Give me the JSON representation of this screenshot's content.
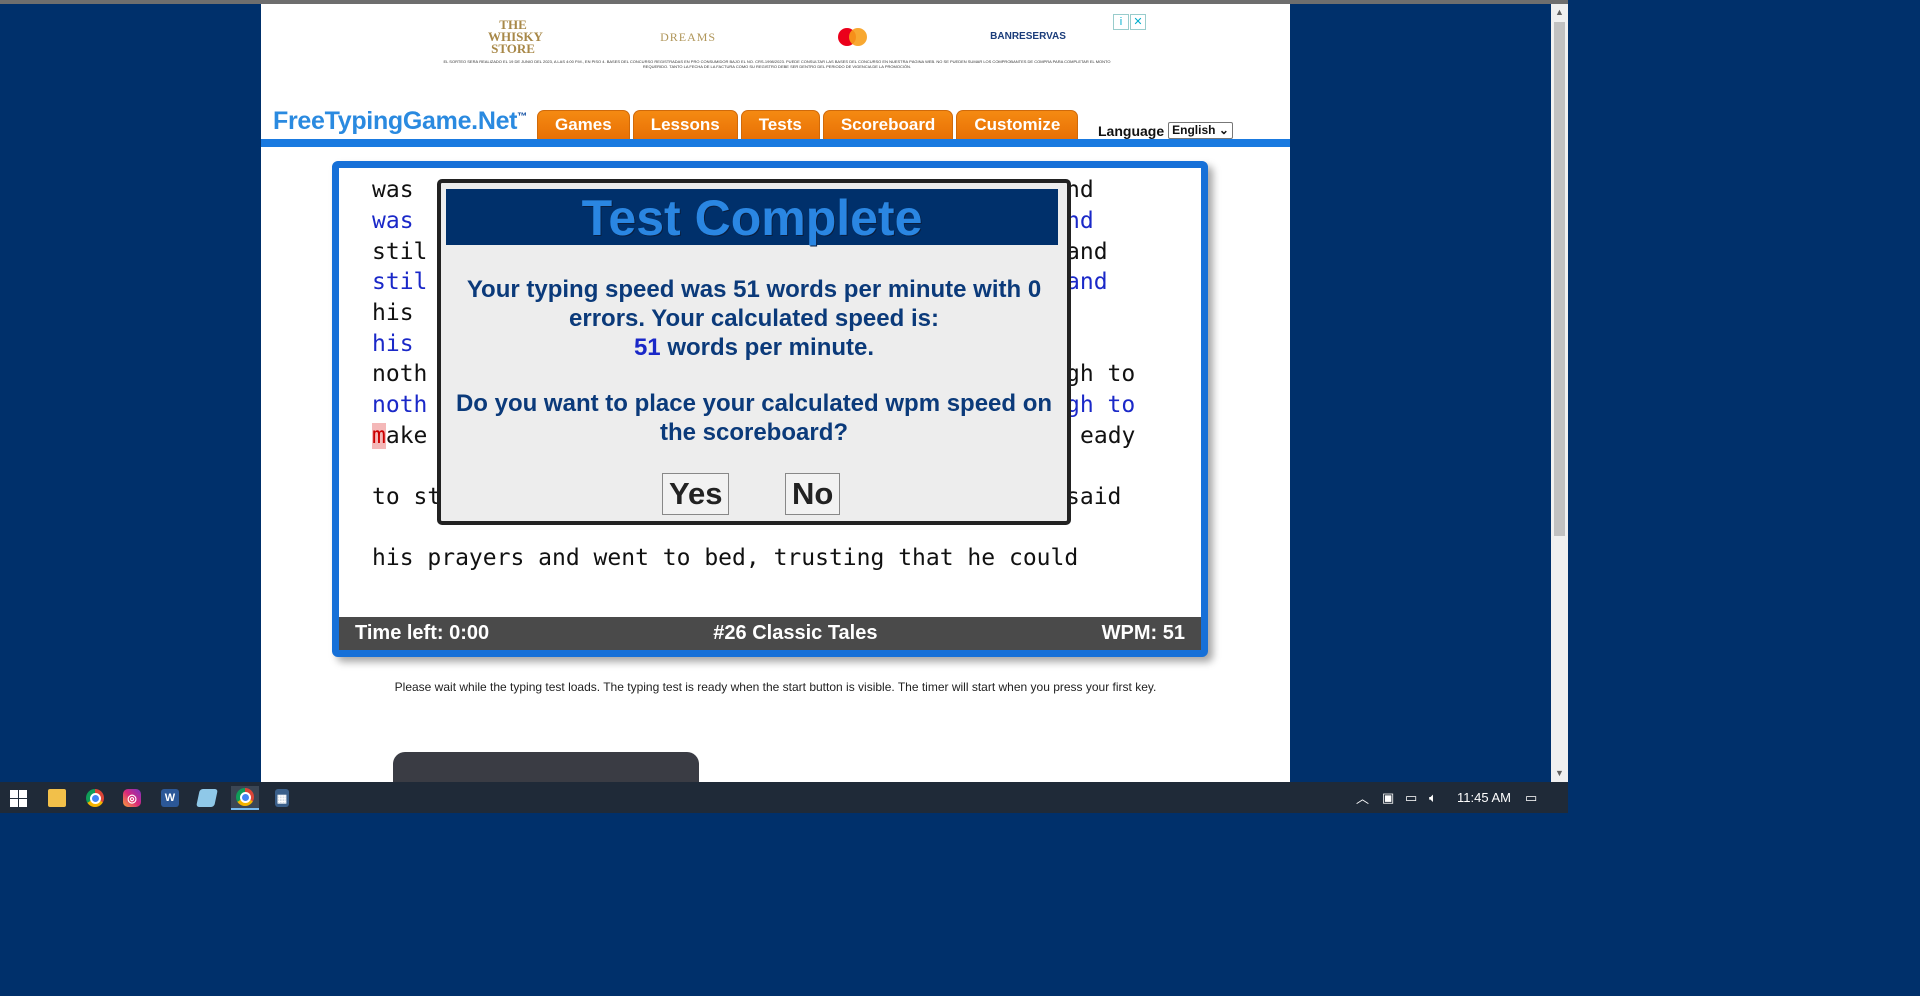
{
  "ad": {
    "logos": [
      "THE WHISKY STORE",
      "DREAMS",
      "mastercard",
      "BANRESERVAS"
    ],
    "fine_print": "EL SORTEO SERÁ REALIZADO EL 19 DE JUNIO DEL 2023, A LAS 4:00 P.M., EN PISO 4. BASES DEL CONCURSO REGISTRADAS EN PRO CONSUMIDOR BAJO EL NO. CRS-1998/2023. PUEDE CONSULTAR LAS BASES DEL CONCURSO EN NUESTRA PÁGINA WEB. NO SE PUEDEN SUMAR LOS COMPROBANTES DE COMPRA PARA COMPLETAR EL MONTO REQUERIDO. TANTO LA FECHA DE LA FACTURA COMO SU REGISTRO DEBE SER DENTRO DEL PERIODO DE VIGENCIA DE LA PROMOCIÓN.",
    "info_icon": "info-icon",
    "close_icon": "close-icon"
  },
  "header": {
    "logo_text": "FreeTypingGame.Net",
    "logo_tm": "™",
    "nav": [
      "Games",
      "Lessons",
      "Tests",
      "Scoreboard",
      "Customize"
    ],
    "language_label": "Language",
    "language_value": "English"
  },
  "typing": {
    "lines": [
      {
        "left": "was ",
        "right": "nd",
        "typed": false
      },
      {
        "left": "was ",
        "right": "nd",
        "typed": true
      },
      {
        "left": "stil",
        "right": "and",
        "typed": false
      },
      {
        "left": "stil",
        "right": "and",
        "typed": true
      },
      {
        "left": "his ",
        "right": "",
        "typed": false
      },
      {
        "left": "his ",
        "right": "",
        "typed": true
      },
      {
        "left": "noth",
        "right": "gh to",
        "typed": false
      },
      {
        "left": "noth",
        "right": "gh to",
        "typed": true
      },
      {
        "left_cursor": "m",
        "left": "ake",
        "right": "eady",
        "typed": false
      },
      {
        "left": "to st",
        "right": "said",
        "typed": false
      },
      {
        "left": "his prayers and went to bed, trusting that he could",
        "right": "",
        "typed": false
      }
    ],
    "status": {
      "time_left": "Time left: 0:00",
      "test_name": "#26 Classic Tales",
      "wpm": "WPM: 51"
    }
  },
  "footnote": "Please wait while the typing test loads. The typing test is ready when the start button is visible. The timer will start when you press your first key.",
  "modal": {
    "title": "Test Complete",
    "msg_part1": "Your typing speed was 51 words per minute with 0 errors. Your calculated speed is:",
    "calc_wpm": "51",
    "msg_part2": " words per minute.",
    "question": "Do you want to place your calculated wpm speed on the scoreboard?",
    "yes": "Yes",
    "no": "No"
  },
  "taskbar": {
    "time": "11:45 AM",
    "apps": [
      "start",
      "file-explorer",
      "chrome",
      "instagram",
      "word",
      "notepad",
      "chrome-active",
      "calculator"
    ]
  }
}
